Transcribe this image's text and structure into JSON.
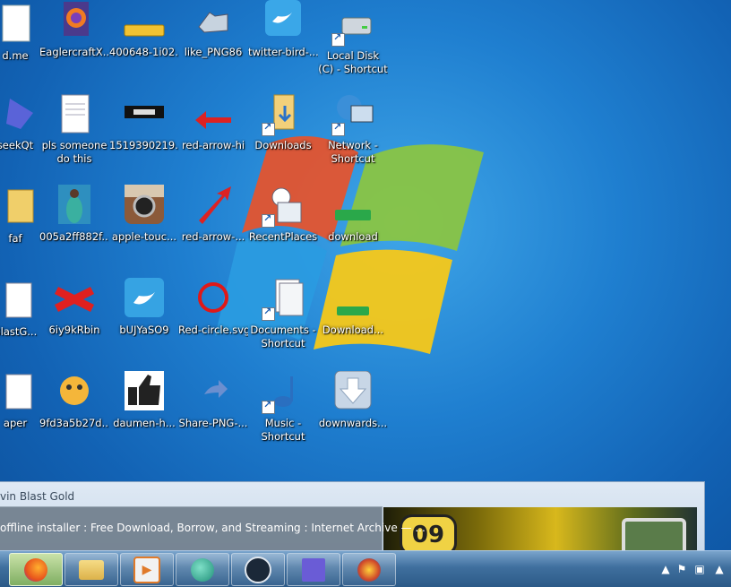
{
  "desktop_icons": [
    {
      "id": "r1c0",
      "label": "d.me",
      "icon": "document-icon"
    },
    {
      "id": "r1c1",
      "label": "EaglercraftX...",
      "icon": "firefox-html-icon"
    },
    {
      "id": "r1c2",
      "label": "400648-1i02...",
      "icon": "subscribe-button-icon"
    },
    {
      "id": "r1c3",
      "label": "like_PNG86",
      "icon": "thumbs-up-hand-icon"
    },
    {
      "id": "r1c4",
      "label": "twitter-bird-...",
      "icon": "twitter-icon"
    },
    {
      "id": "r1c5",
      "label": "Local Disk (C) - Shortcut",
      "icon": "hard-drive-icon"
    },
    {
      "id": "r2c0",
      "label": "seekQt",
      "icon": "blue-bird-icon"
    },
    {
      "id": "r2c1",
      "label": "pls someone do this",
      "icon": "text-file-icon"
    },
    {
      "id": "r2c2",
      "label": "1519390219...",
      "icon": "banner-image-icon"
    },
    {
      "id": "r2c3",
      "label": "red-arrow-hi",
      "icon": "red-left-arrow-icon"
    },
    {
      "id": "r2c4",
      "label": "Downloads",
      "icon": "downloads-folder-icon"
    },
    {
      "id": "r2c5",
      "label": "Network - Shortcut",
      "icon": "network-globe-icon"
    },
    {
      "id": "r3c0",
      "label": "faf",
      "icon": "folder-icon"
    },
    {
      "id": "r3c1",
      "label": "005a2ff882f...",
      "icon": "photo-person-icon"
    },
    {
      "id": "r3c2",
      "label": "apple-touc...",
      "icon": "instagram-icon"
    },
    {
      "id": "r3c3",
      "label": "red-arrow-...",
      "icon": "red-diagonal-arrow-icon"
    },
    {
      "id": "r3c4",
      "label": "RecentPlaces",
      "icon": "recent-places-icon"
    },
    {
      "id": "r3c5",
      "label": "download",
      "icon": "green-download-button-icon"
    },
    {
      "id": "r4c0",
      "label": "BlastG...",
      "icon": "document-icon"
    },
    {
      "id": "r4c1",
      "label": "6iy9kRbin",
      "icon": "red-x-icon"
    },
    {
      "id": "r4c2",
      "label": "bUJYaSO9",
      "icon": "twitter-square-icon"
    },
    {
      "id": "r4c3",
      "label": "Red-circle.svg",
      "icon": "red-circle-icon"
    },
    {
      "id": "r4c4",
      "label": "Documents - Shortcut",
      "icon": "documents-icon"
    },
    {
      "id": "r4c5",
      "label": "Download...",
      "icon": "green-download-small-icon"
    },
    {
      "id": "r5c0",
      "label": "aper",
      "icon": "text-file-icon"
    },
    {
      "id": "r5c1",
      "label": "9fd3a5b27d...",
      "icon": "emoji-face-icon"
    },
    {
      "id": "r5c2",
      "label": "daumen-h...",
      "icon": "thumbs-up-black-icon"
    },
    {
      "id": "r5c3",
      "label": "Share-PNG-...",
      "icon": "share-arrow-icon"
    },
    {
      "id": "r5c4",
      "label": "Music - Shortcut",
      "icon": "music-note-icon"
    },
    {
      "id": "r5c5",
      "label": "downwards...",
      "icon": "down-arrow-button-icon"
    }
  ],
  "window_preview": {
    "title": "vin Blast Gold",
    "thumbnail_badge": "09"
  },
  "tab_tooltip": {
    "text": "offline installer : Free Download, Borrow, and Streaming : Internet Archive — ..."
  },
  "taskbar": {
    "buttons": [
      {
        "name": "firefox",
        "icon": "firefox-icon",
        "active": true,
        "color": "#e8681c"
      },
      {
        "name": "file-explorer",
        "icon": "folder-icon",
        "active": false,
        "color": "#e7c24a"
      },
      {
        "name": "media-player",
        "icon": "media-player-icon",
        "active": false,
        "color": "#e07a2a"
      },
      {
        "name": "app-green-circle",
        "icon": "green-circle-app-icon",
        "active": false,
        "color": "#2aa58a"
      },
      {
        "name": "steam",
        "icon": "steam-icon",
        "active": false,
        "color": "#1b2838"
      },
      {
        "name": "blue-bird-app",
        "icon": "blue-bird-icon",
        "active": false,
        "color": "#6a5cd6"
      },
      {
        "name": "game-app",
        "icon": "starburst-game-icon",
        "active": false,
        "color": "#d04a2a"
      }
    ],
    "tray": [
      "show-hidden-icons-icon",
      "flag-icon",
      "network-icon",
      "volume-icon"
    ]
  },
  "colors": {
    "wallpaper": "#1f7fd0",
    "taskbar": "#3f6f9e",
    "active_taskbar_button": "#9cc77a"
  }
}
